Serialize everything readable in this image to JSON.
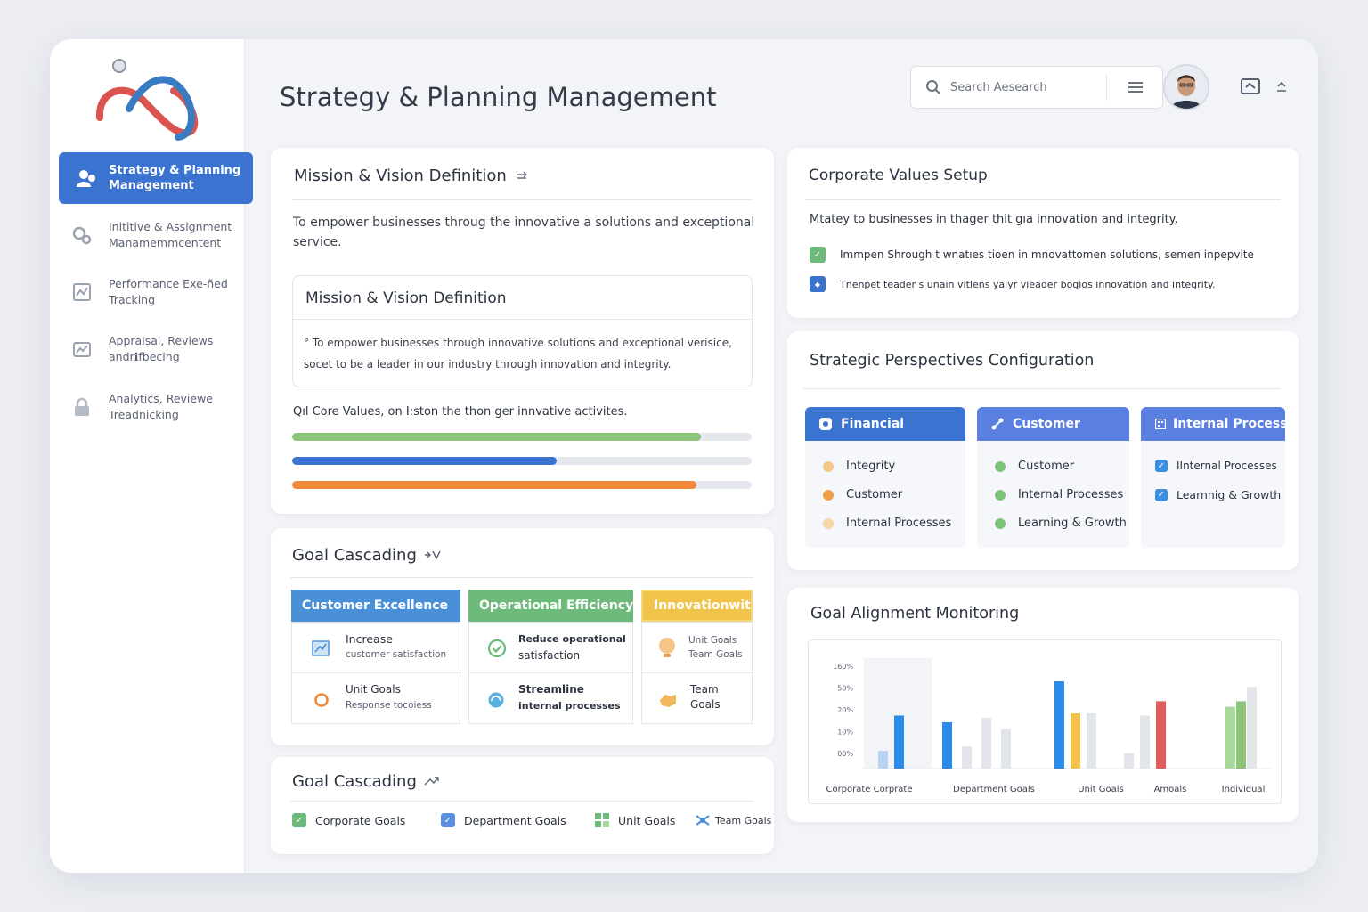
{
  "header": {
    "title": "Strategy & Planning Management",
    "search_placeholder": "Search Aesearch"
  },
  "sidebar": {
    "items": [
      {
        "label": "Strategy & Planning Management",
        "icon": "people-icon",
        "active": true
      },
      {
        "label": "Inititive & Assignment Manamemmcentent",
        "icon": "gears-icon"
      },
      {
        "label": "Performance Exe-ñed Tracking",
        "icon": "tracking-icon"
      },
      {
        "label": "Appraisal, Reviews andrℹ︎fbecing",
        "icon": "chart-icon"
      },
      {
        "label": "Analytics, Reviewe Treadnicking",
        "icon": "lock-icon"
      }
    ]
  },
  "mission": {
    "title": "Mission & Vision Definition",
    "statement": "To empower businesses throug the innovative a solutions and exceptional service.",
    "inner_title": "Mission & Vision Definition",
    "inner_text": "° To empower businesses through innovative solutions and exceptional verisice, socet to be a leader in our industry through innovation and integrity.",
    "core_values_text": "Qıl Core Values, on I:ston the thon ger innvative activites.",
    "progress": [
      {
        "value": 0.89,
        "color": "#8cc47a"
      },
      {
        "value": 0.575,
        "color": "#3b73d0"
      },
      {
        "value": 0.88,
        "color": "#f0883e"
      }
    ]
  },
  "goal_cascading": {
    "title": "Goal Cascading",
    "columns": [
      {
        "header": "Customer Excellence",
        "color": "#4a90d9",
        "cells": [
          {
            "title": "Increase",
            "sub": "customer satisfaction",
            "icon": "chart-icon"
          },
          {
            "title": "Unit Goals",
            "sub": "Response tocoiess",
            "icon": "ring-icon"
          }
        ]
      },
      {
        "header": "Operational Efficiency",
        "color": "#6dba7a",
        "cells": [
          {
            "title": "Reduce operational",
            "sub": "satisfaction",
            "icon": "check-circle-icon"
          },
          {
            "title": "Streamline",
            "sub": "internal processes",
            "icon": "gauge-icon"
          }
        ]
      },
      {
        "header": "Innovationwith",
        "color": "#f2c34a",
        "cells": [
          {
            "title": "Unit Goals",
            "sub": "Team Goals",
            "icon": "bulb-icon"
          },
          {
            "title": "Team",
            "sub": "Goals",
            "icon": "hand-icon"
          }
        ]
      }
    ]
  },
  "goal_cascading_2": {
    "title": "Goal Cascading",
    "legend": [
      {
        "label": "Corporate Goals",
        "icon": "checkbox-green-icon"
      },
      {
        "label": "Department Goals",
        "icon": "checkbox-blue-icon"
      },
      {
        "label": "Unit Goals",
        "icon": "grid-icon"
      },
      {
        "label": "Team Goals",
        "icon": "team-icon"
      }
    ]
  },
  "corporate_values": {
    "title": "Corporate Values Setup",
    "intro": "Mtatey to businesses in thager thit gıa innovation and integrity.",
    "items": [
      {
        "text": "Immpen Shrough t wnatıes tioen in mnovattomen solutions, semen inpepvite",
        "icon": "check-green-icon"
      },
      {
        "text": "Tnenpet teader s unaın vitlens yaıyr vieader bogios innovation and integrity.",
        "icon": "diamond-blue-icon"
      }
    ]
  },
  "perspectives": {
    "title": "Strategic Perspectives Configuration",
    "columns": [
      {
        "header": "Financial",
        "color": "#3b73d0",
        "icon": "coin-icon",
        "items": [
          {
            "label": "Integrity",
            "dot": "#f5c98a"
          },
          {
            "label": "Customer",
            "dot": "#f0a044"
          },
          {
            "label": "Internal Processes",
            "dot": "#f6d7a6"
          }
        ]
      },
      {
        "header": "Customer",
        "color": "#5a7fe0",
        "icon": "link-icon",
        "items": [
          {
            "label": "Customer",
            "dot": "#7cc47a"
          },
          {
            "label": "Internal Processes",
            "dot": "#7cc47a"
          },
          {
            "label": "Learning & Growth",
            "dot": "#7cc47a"
          }
        ]
      },
      {
        "header": "Internal Process",
        "color": "#5a7fe0",
        "icon": "building-icon",
        "items": [
          {
            "label": "IInternal Processes",
            "check": true
          },
          {
            "label": "Learnnig & Growth",
            "check": true
          }
        ]
      }
    ]
  },
  "alignment": {
    "title": "Goal Alignment Monitoring"
  },
  "chart_data": {
    "type": "bar",
    "title": "Goal Alignment Monitoring",
    "ytick_labels": [
      "160%",
      "50%",
      "20%",
      "10%",
      "00%"
    ],
    "categories": [
      "Corporate Corprate",
      "Department Goals",
      "Unit Goals",
      "Amoals",
      "Individual"
    ],
    "groups": [
      {
        "category": "Corporate Corprate",
        "bars": [
          {
            "value": 0.16,
            "color": "#b8d4f2"
          },
          {
            "value": 0.48,
            "color": "#2a8be8"
          }
        ]
      },
      {
        "category": "Department Goals",
        "bars": [
          {
            "value": 0.42,
            "color": "#2a8be8"
          },
          {
            "value": 0.2,
            "color": "#e2e5ea"
          },
          {
            "value": 0.46,
            "color": "#e2e5ea"
          },
          {
            "value": 0.36,
            "color": "#e2e5ea"
          }
        ]
      },
      {
        "category": "Unit Goals",
        "bars": [
          {
            "value": 0.79,
            "color": "#2a8be8"
          },
          {
            "value": 0.5,
            "color": "#f2c34a"
          },
          {
            "value": 0.5,
            "color": "#e2e5ea"
          }
        ]
      },
      {
        "category": "Amoals",
        "bars": [
          {
            "value": 0.14,
            "color": "#e2e5ea"
          },
          {
            "value": 0.48,
            "color": "#e2e5ea"
          },
          {
            "value": 0.61,
            "color": "#e25c5c"
          }
        ]
      },
      {
        "category": "Individual",
        "bars": [
          {
            "value": 0.56,
            "color": "#a8d89a"
          },
          {
            "value": 0.61,
            "color": "#8cc47a"
          },
          {
            "value": 0.74,
            "color": "#e2e5ea"
          }
        ]
      }
    ]
  }
}
